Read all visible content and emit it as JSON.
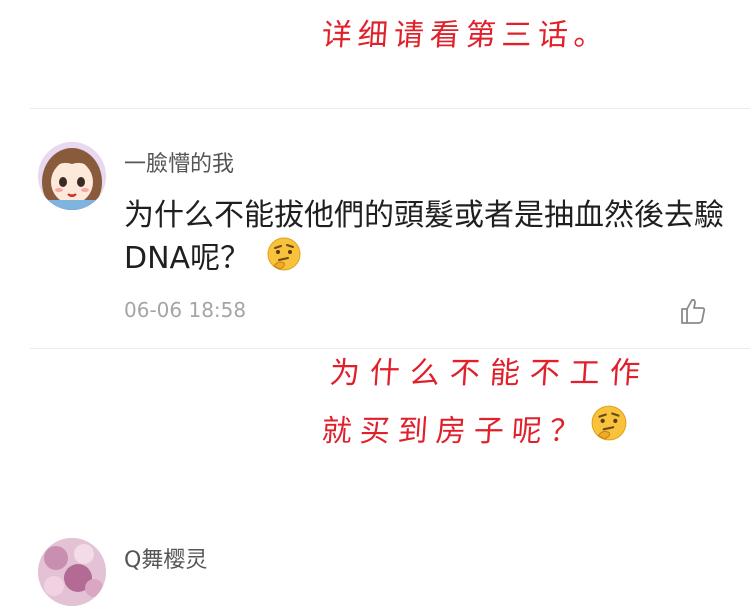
{
  "annotations": {
    "top": "详细请看第三话。",
    "middle_line1": "为什么不能不工作",
    "middle_line2": "就买到房子呢？"
  },
  "comments": [
    {
      "username": "一臉懵的我",
      "text": "为什么不能拔他們的頭髮或者是抽血然後去驗DNA呢？",
      "emoji": "thinking-face-emoji",
      "timestamp": "06-06 18:58",
      "like_icon": "thumbs-up-icon"
    },
    {
      "username": "Q舞樱灵"
    }
  ],
  "colors": {
    "annotation_red": "#e0202a",
    "username_gray": "#555555",
    "timestamp_gray": "#a5a5a5",
    "text": "#1f1f1f"
  }
}
